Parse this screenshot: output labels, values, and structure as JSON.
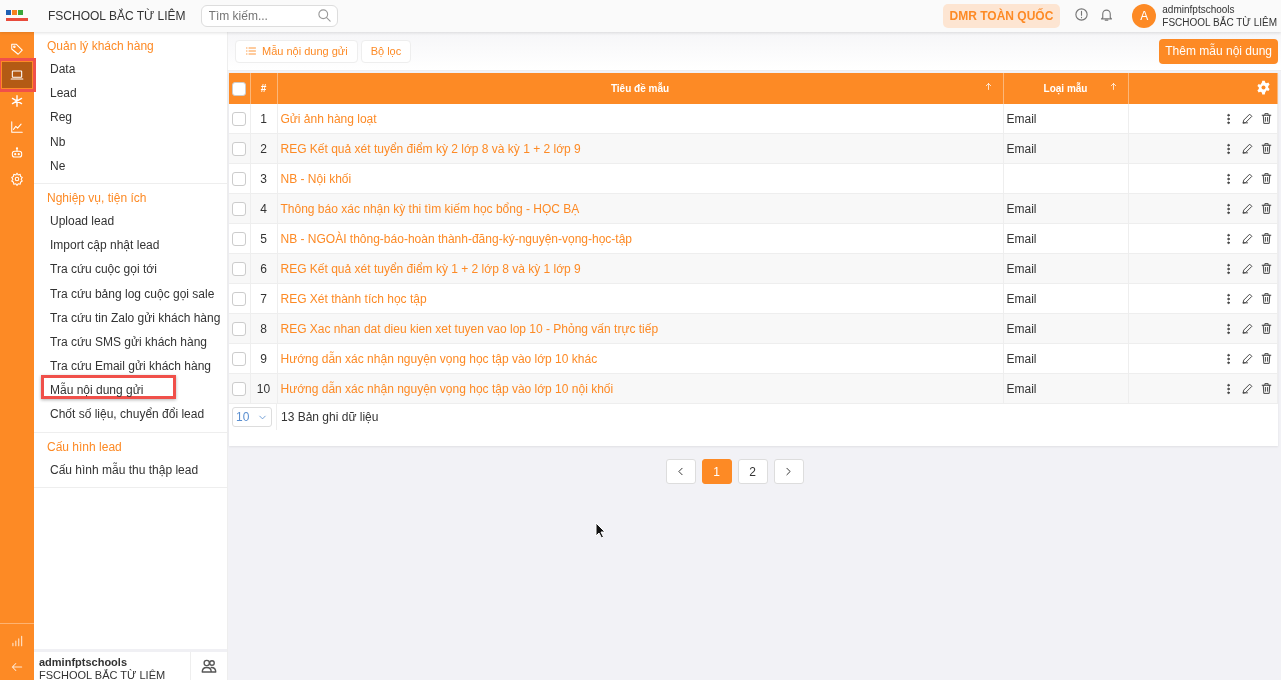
{
  "header": {
    "brand": "FSCHOOL BẮC TỪ LIÊM",
    "search": {
      "placeholder": "Tìm kiếm..."
    },
    "scope_button": "DMR TOÀN QUỐC",
    "user": {
      "avatar": "A",
      "name": "adminfptschools",
      "unit": "FSCHOOL BẮC TỪ LIÊM"
    }
  },
  "rail": [
    {
      "selected": false,
      "highlighted": false
    },
    {
      "selected": true,
      "highlighted": true
    },
    {
      "selected": false,
      "highlighted": false
    },
    {
      "selected": false,
      "highlighted": false
    },
    {
      "selected": false,
      "highlighted": false
    },
    {
      "selected": false,
      "highlighted": false
    }
  ],
  "sidebar": {
    "sections": [
      {
        "title": "Quản lý khách hàng",
        "items": [
          {
            "label": "Data",
            "highlighted": false
          },
          {
            "label": "Lead",
            "highlighted": false
          },
          {
            "label": "Reg",
            "highlighted": false
          },
          {
            "label": "Nb",
            "highlighted": false
          },
          {
            "label": "Ne",
            "highlighted": false
          }
        ]
      },
      {
        "title": "Nghiệp vụ, tiện ích",
        "items": [
          {
            "label": "Upload lead",
            "highlighted": false
          },
          {
            "label": "Import cập nhật lead",
            "highlighted": false
          },
          {
            "label": "Tra cứu cuộc gọi tới",
            "highlighted": false
          },
          {
            "label": "Tra cứu bảng log cuộc gọi sale",
            "highlighted": false
          },
          {
            "label": "Tra cứu tin Zalo gửi khách hàng",
            "highlighted": false
          },
          {
            "label": "Tra cứu SMS gửi khách hàng",
            "highlighted": false
          },
          {
            "label": "Tra cứu Email gửi khách hàng",
            "highlighted": false
          },
          {
            "label": "Mẫu nội dung gửi",
            "highlighted": true
          },
          {
            "label": "Chốt số liệu, chuyển đổi lead",
            "highlighted": false
          }
        ]
      },
      {
        "title": "Cấu hình lead",
        "items": [
          {
            "label": "Cấu hình mẫu thu thập lead",
            "highlighted": false
          }
        ]
      }
    ],
    "user": {
      "name": "adminfptschools",
      "unit": "FSCHOOL BẮC TỪ LIÊM"
    }
  },
  "toolbar": {
    "tabs": [
      {
        "label": "Mẫu nội dung gửi",
        "kind": "list"
      },
      {
        "label": "Bộ lọc",
        "kind": "plain"
      }
    ],
    "add_button": "Thêm mẫu nội dung"
  },
  "table": {
    "all_checked": false,
    "columns": [
      {
        "label": "#",
        "sortable": false
      },
      {
        "label": "Tiêu đề mẫu",
        "sortable": true
      },
      {
        "label": "Loại mẫu",
        "sortable": true
      }
    ],
    "rows": [
      {
        "no": "1",
        "title": "Gửi ảnh hàng loạt",
        "type": "Email",
        "checked": false
      },
      {
        "no": "2",
        "title": "REG Kết quả xét tuyển điểm kỳ 2 lớp 8 và kỳ 1 + 2 lớp 9",
        "type": "Email",
        "checked": false
      },
      {
        "no": "3",
        "title": "NB - Nội khối",
        "type": "",
        "checked": false
      },
      {
        "no": "4",
        "title": "Thông báo xác nhận kỳ thi tìm kiếm học bổng - HỌC BẠ",
        "type": "Email",
        "checked": false
      },
      {
        "no": "5",
        "title": "NB - NGOÀI thông-báo-hoàn thành-đăng-ký-nguyện-vọng-học-tập",
        "type": "Email",
        "checked": false
      },
      {
        "no": "6",
        "title": "REG Kết quả xét tuyển điểm kỳ 1 + 2 lớp 8 và kỳ 1 lớp 9",
        "type": "Email",
        "checked": false
      },
      {
        "no": "7",
        "title": "REG Xét thành tích học tập",
        "type": "Email",
        "checked": false
      },
      {
        "no": "8",
        "title": "REG Xac nhan dat dieu kien xet tuyen vao lop 10 - Phỏng vấn trực tiếp",
        "type": "Email",
        "checked": false
      },
      {
        "no": "9",
        "title": "Hướng dẫn xác nhận nguyện vọng học tập vào lớp 10 khác",
        "type": "Email",
        "checked": false
      },
      {
        "no": "10",
        "title": "Hướng dẫn xác nhận nguyện vọng học tập vào lớp 10 nội khối",
        "type": "Email",
        "checked": false
      }
    ],
    "page_size": "10",
    "total": "13 Bản ghi dữ liệu"
  },
  "pagination": [
    {
      "label": "1",
      "selected": true
    },
    {
      "label": "2",
      "selected": false
    }
  ]
}
